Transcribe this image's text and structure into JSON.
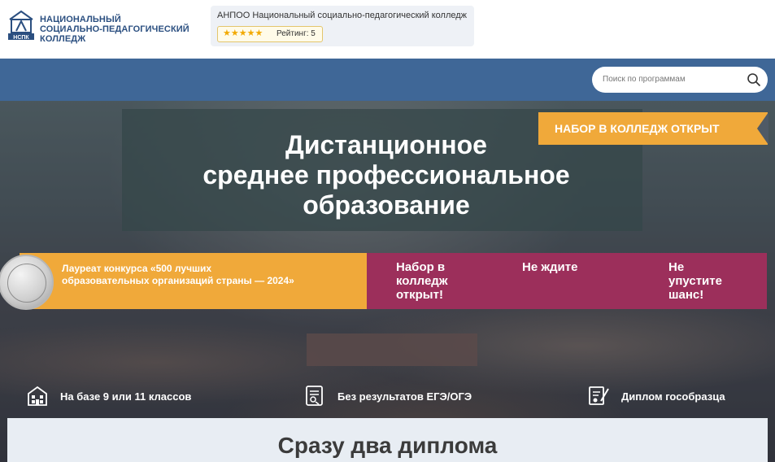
{
  "header": {
    "logo_icon": "college-logo-icon",
    "logo_abbr": "НСПК",
    "logo_lines": [
      "НАЦИОНАЛЬНЫЙ",
      "СОЦИАЛЬНО-ПЕДАГОГИЧЕСКИЙ",
      "КОЛЛЕДЖ"
    ]
  },
  "rating": {
    "org_name": "АНПОО Национальный социально-педагогический колледж",
    "stars": "★★★★★",
    "value_text": "Рейтинг: 5",
    "star_color": "#f2a900"
  },
  "search": {
    "placeholder": "Поиск по программам",
    "icon": "search-icon"
  },
  "hero": {
    "banner": "НАБОР В КОЛЛЕДЖ ОТКРЫТ",
    "title_lines": [
      "Дистанционное",
      "среднее профессиональное",
      "образование"
    ],
    "laureate_lines": [
      "Лауреат конкурса «500 лучших",
      "образовательных организаций страны — 2024»"
    ],
    "medal_icon": "medal-icon",
    "callouts": [
      {
        "lines": [
          "Набор в",
          "колледж",
          "открыт!"
        ]
      },
      {
        "lines": [
          "Не ждите"
        ]
      },
      {
        "lines": [
          "Не",
          "упустите",
          "шанс!"
        ]
      }
    ]
  },
  "features": [
    {
      "icon": "building-icon",
      "label": "На базе 9 или 11 классов"
    },
    {
      "icon": "document-icon",
      "label": "Без результатов ЕГЭ/ОГЭ"
    },
    {
      "icon": "diploma-icon",
      "label": "Диплом гособразца"
    }
  ],
  "section": {
    "title": "Сразу два диплома"
  },
  "colors": {
    "brand_blue": "#3f6797",
    "accent_orange": "#f0a93a",
    "accent_maroon": "#9c2f5b"
  }
}
